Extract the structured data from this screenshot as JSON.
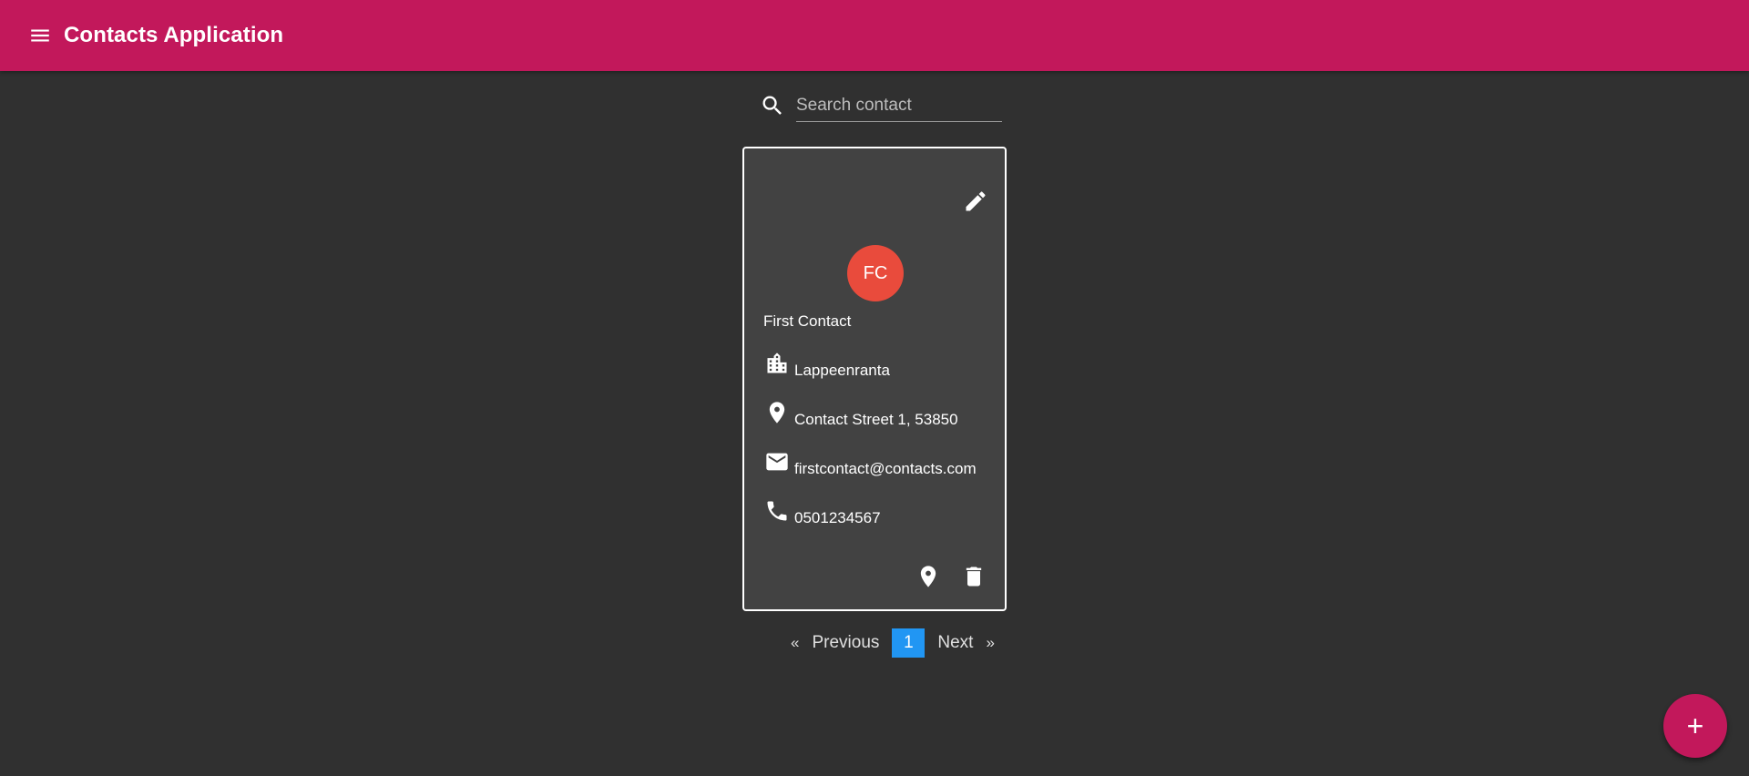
{
  "app": {
    "title": "Contacts Application",
    "menu_icon": "menu-icon",
    "colors": {
      "toolbar": "#c2185b",
      "background": "#303030",
      "card": "#424242",
      "avatar": "#e94b3c",
      "page_active": "#2196f3",
      "fab": "#c2185b"
    }
  },
  "search": {
    "placeholder": "Search contact",
    "value": "",
    "icon": "search-icon"
  },
  "contact": {
    "initials": "FC",
    "name": "First Contact",
    "city": "Lappeenranta",
    "address": "Contact Street 1, 53850",
    "email": "firstcontact@contacts.com",
    "phone": "0501234567",
    "icons": {
      "edit": "edit-icon",
      "city": "city-icon",
      "address": "location-pin-icon",
      "email": "mail-icon",
      "phone": "phone-icon",
      "map": "location-pin-icon",
      "delete": "trash-icon"
    }
  },
  "pagination": {
    "first_symbol": "«",
    "previous": "Previous",
    "current_page": "1",
    "next": "Next",
    "last_symbol": "»"
  },
  "fab": {
    "label": "+",
    "icon": "add-icon"
  }
}
